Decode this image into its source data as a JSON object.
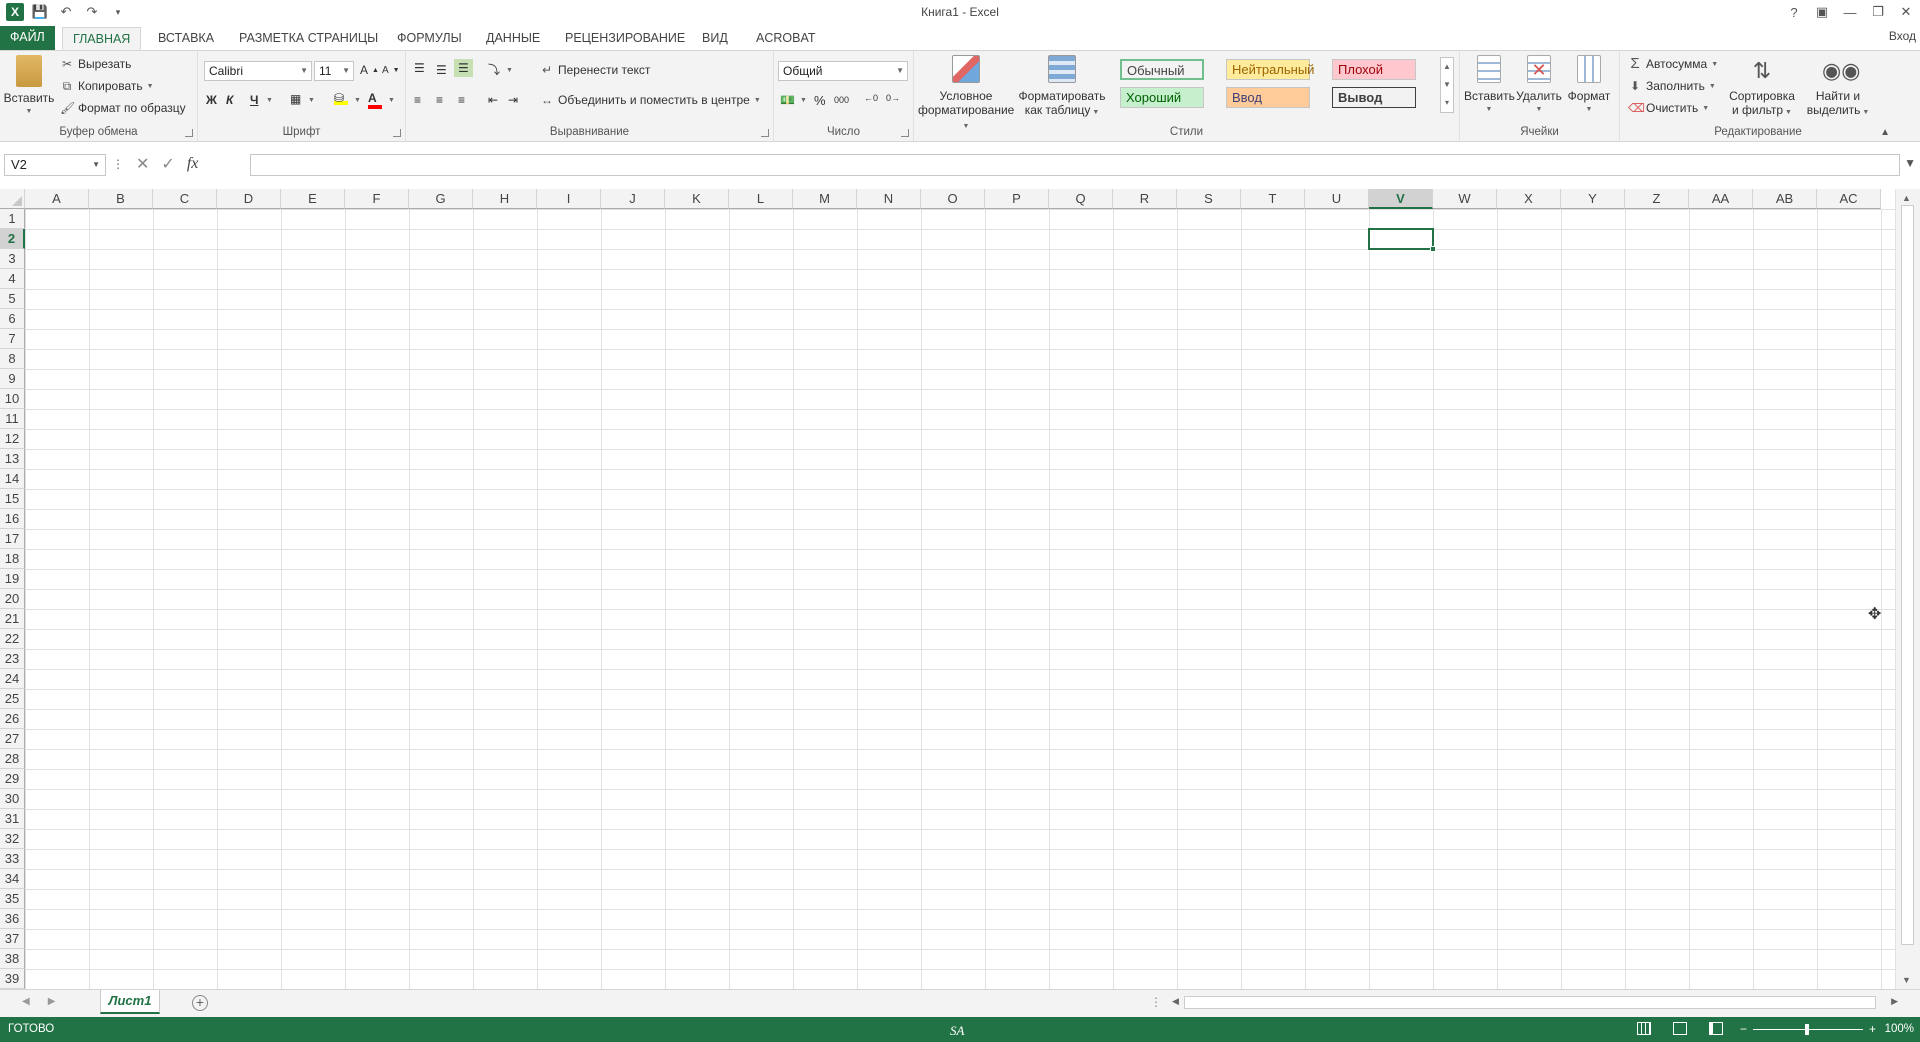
{
  "app": {
    "window_title": "Книга1 - Excel",
    "sign_in": "Вход"
  },
  "tabs": [
    {
      "label": "ФАЙЛ"
    },
    {
      "label": "ГЛАВНАЯ"
    },
    {
      "label": "ВСТАВКА"
    },
    {
      "label": "РАЗМЕТКА СТРАНИЦЫ"
    },
    {
      "label": "ФОРМУЛЫ"
    },
    {
      "label": "ДАННЫЕ"
    },
    {
      "label": "РЕЦЕНЗИРОВАНИЕ"
    },
    {
      "label": "ВИД"
    },
    {
      "label": "ACROBAT"
    }
  ],
  "clipboard": {
    "group_label": "Буфер обмена",
    "paste": "Вставить",
    "cut": "Вырезать",
    "copy": "Копировать",
    "format_painter": "Формат по образцу"
  },
  "font": {
    "group_label": "Шрифт",
    "font_name": "Calibri",
    "font_size": "11",
    "bold": "Ж",
    "italic": "К",
    "underline": "Ч"
  },
  "alignment": {
    "group_label": "Выравнивание",
    "wrap_text": "Перенести текст",
    "merge_center": "Объединить и поместить в центре"
  },
  "number": {
    "group_label": "Число",
    "format": "Общий",
    "percent": "%",
    "thousands": "000"
  },
  "styles": {
    "group_label": "Стили",
    "conditional_line1": "Условное",
    "conditional_line2": "форматирование",
    "format_table_line1": "Форматировать",
    "format_table_line2": "как таблицу",
    "cells": [
      {
        "label": "Обычный",
        "bg": "#ffffff",
        "fg": "#000000"
      },
      {
        "label": "Нейтральный",
        "bg": "#ffeb9c",
        "fg": "#9c6500"
      },
      {
        "label": "Плохой",
        "bg": "#ffc7ce",
        "fg": "#9c0006"
      },
      {
        "label": "Хороший",
        "bg": "#c6efce",
        "fg": "#006100"
      },
      {
        "label": "Ввод",
        "bg": "#ffcc99",
        "fg": "#3f3f76"
      },
      {
        "label": "Вывод",
        "bg": "#f2f2f2",
        "fg": "#3f3f3f"
      }
    ]
  },
  "cells_group": {
    "group_label": "Ячейки",
    "insert": "Вставить",
    "delete": "Удалить",
    "format": "Формат"
  },
  "editing": {
    "group_label": "Редактирование",
    "autosum": "Автосумма",
    "fill": "Заполнить",
    "clear": "Очистить",
    "sort_line1": "Сортировка",
    "sort_line2": "и фильтр",
    "find_line1": "Найти и",
    "find_line2": "выделить"
  },
  "formula_bar": {
    "name_box": "V2",
    "fx": "fx",
    "value": ""
  },
  "grid": {
    "columns": [
      "A",
      "B",
      "C",
      "D",
      "E",
      "F",
      "G",
      "H",
      "I",
      "J",
      "K",
      "L",
      "M",
      "N",
      "O",
      "P",
      "Q",
      "R",
      "S",
      "T",
      "U",
      "V",
      "W",
      "X",
      "Y",
      "Z",
      "AA",
      "AB",
      "AC"
    ],
    "rows": [
      "1",
      "2",
      "3",
      "4",
      "5",
      "6",
      "7",
      "8",
      "9",
      "10",
      "11",
      "12",
      "13",
      "14",
      "15",
      "16",
      "17",
      "18",
      "19",
      "20",
      "21",
      "22",
      "23",
      "24",
      "25",
      "26",
      "27",
      "28",
      "29",
      "30",
      "31",
      "32",
      "33",
      "34",
      "35",
      "36",
      "37",
      "38",
      "39"
    ],
    "selected_column": "V",
    "selected_row": "2"
  },
  "sheets": [
    {
      "label": "Лист1"
    }
  ],
  "status": {
    "ready": "ГОТОВО",
    "center_text": "SA",
    "zoom": "100%"
  },
  "colors": {
    "accent": "#217346",
    "ribbon_bg": "#f3f3f3",
    "gridline": "#e1e1e1"
  }
}
